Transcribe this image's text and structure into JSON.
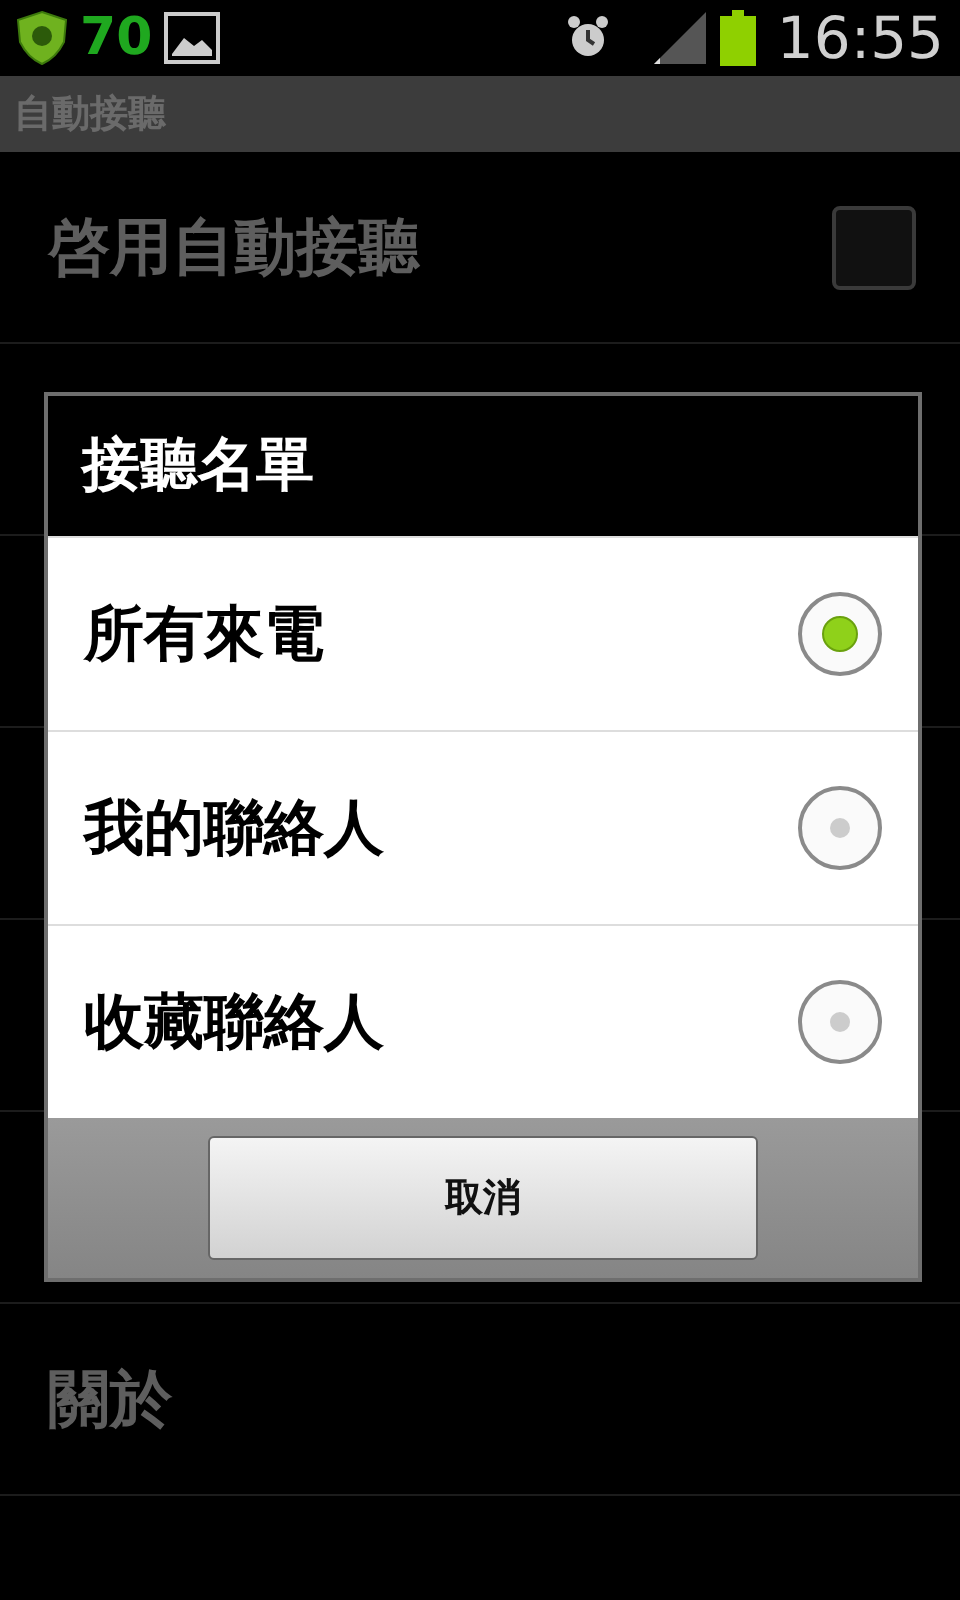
{
  "status_bar": {
    "notification_count": "70",
    "time": "16:55"
  },
  "title_bar": {
    "title": "自動接聽"
  },
  "settings": [
    {
      "label": "啓用自動接聽",
      "kind": "checkbox",
      "checked": false
    },
    {
      "kind": "hidden"
    },
    {
      "kind": "hidden"
    },
    {
      "kind": "hidden"
    },
    {
      "kind": "hidden"
    },
    {
      "kind": "hidden"
    },
    {
      "label": "關於",
      "kind": "plain"
    }
  ],
  "dialog": {
    "title": "接聽名單",
    "options": [
      {
        "label": "所有來電",
        "selected": true
      },
      {
        "label": "我的聯絡人",
        "selected": false
      },
      {
        "label": "收藏聯絡人",
        "selected": false
      }
    ],
    "buttons": [
      "取消"
    ]
  }
}
